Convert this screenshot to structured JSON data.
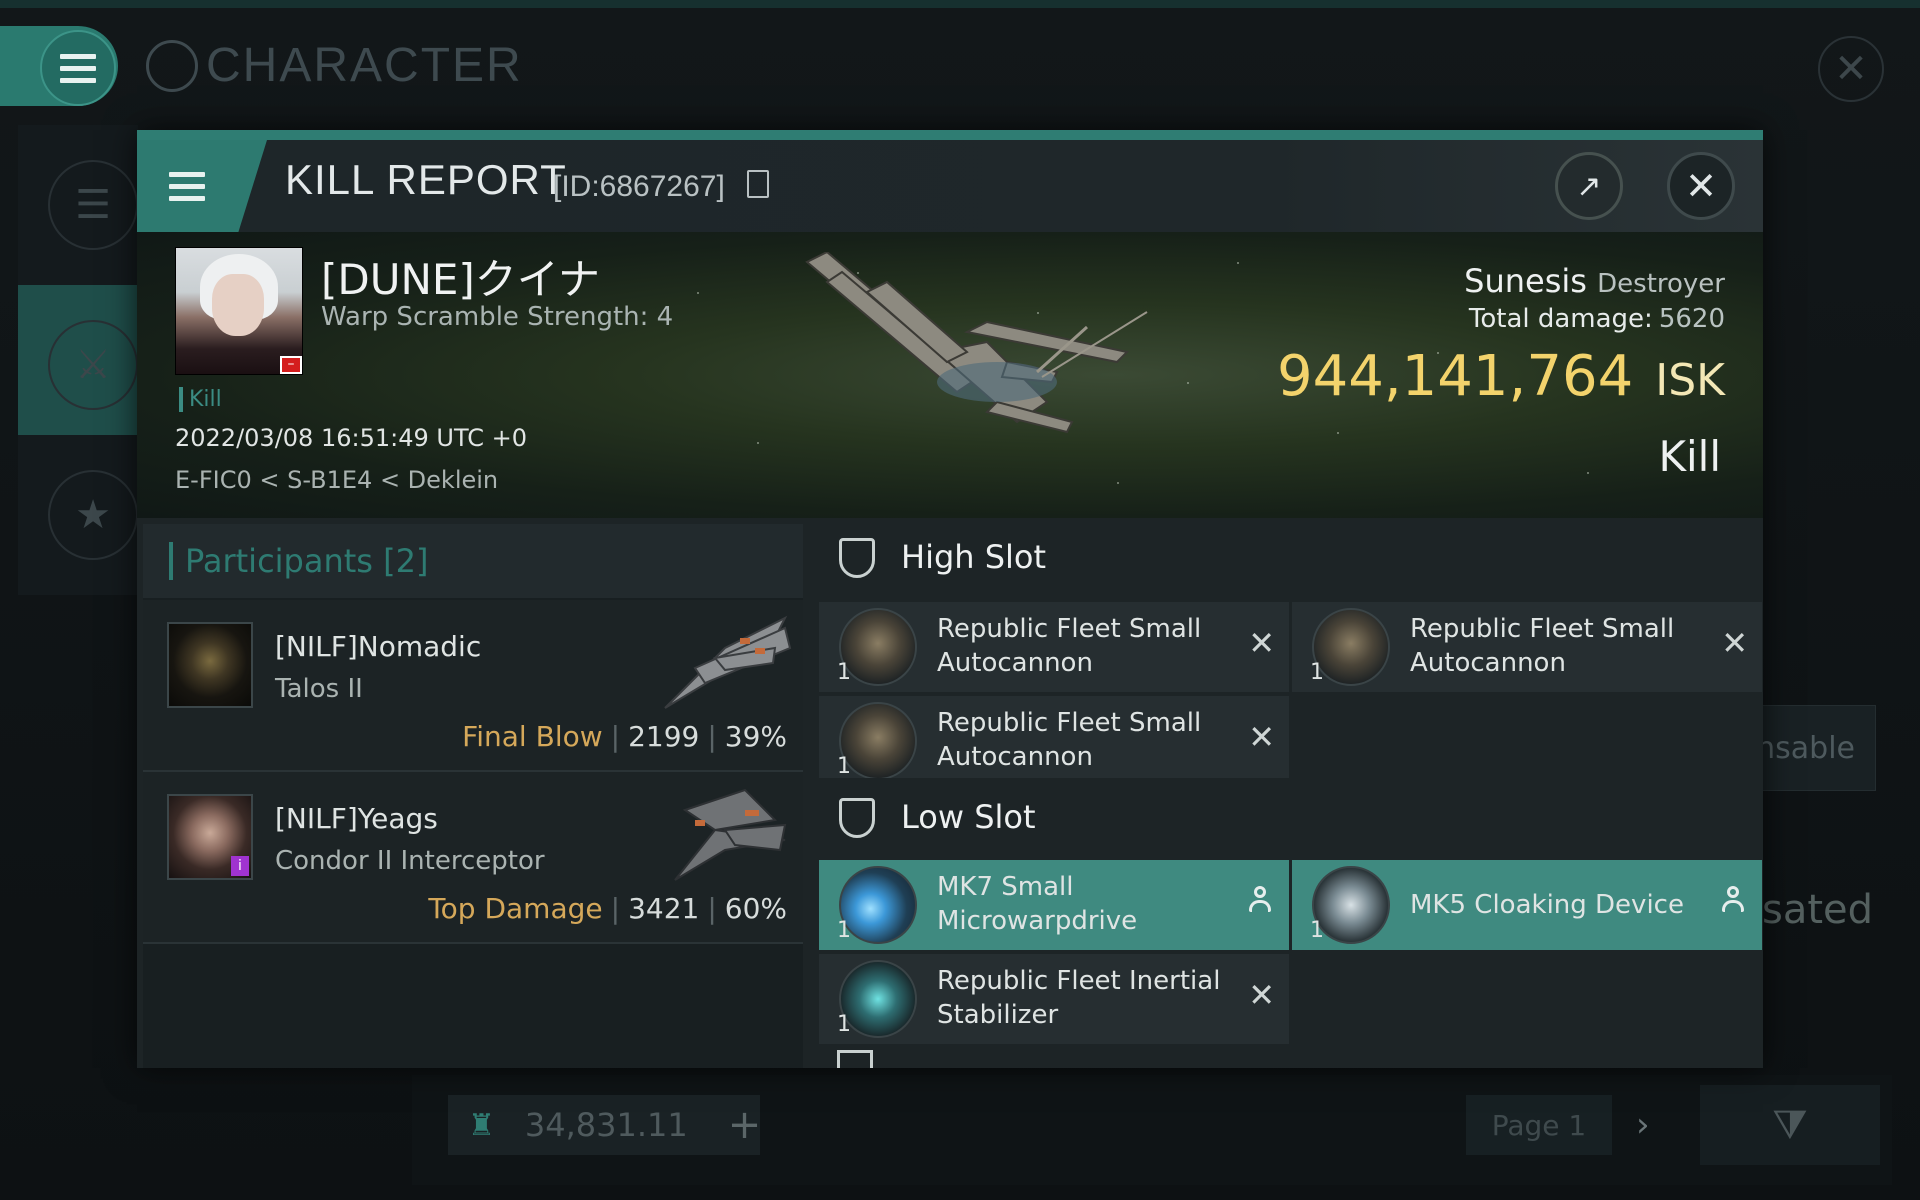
{
  "background_window": {
    "title": "CHARACTER",
    "right_button_1": "nsable",
    "right_text_2": "sated",
    "wallet_value": "34,831.11",
    "wallet_add": "+",
    "page_label": "Page 1",
    "next": "›"
  },
  "kill_report": {
    "title": "KILL REPORT",
    "id_label": "[ID:6867267]",
    "victim": {
      "name": "[DUNE]クイナ",
      "warp_scramble": "Warp Scramble Strength: 4",
      "tag": "Kill",
      "datetime": "2022/03/08 16:51:49 UTC +0",
      "location": "E-FIC0 < S-B1E4 < Deklein"
    },
    "ship": {
      "name": "Sunesis",
      "class": "Destroyer",
      "total_damage_label": "Total damage:",
      "total_damage": "5620",
      "value": "944,141,764",
      "currency": "ISK",
      "kind": "Kill"
    },
    "participants": {
      "label": "Participants",
      "count": "[2]",
      "items": [
        {
          "name": "[NILF]Nomadic",
          "ship": "Talos II",
          "role": "Final Blow",
          "damage": "2199",
          "percent": "39%"
        },
        {
          "name": "[NILF]Yeags",
          "ship": "Condor II Interceptor",
          "role": "Top Damage",
          "damage": "3421",
          "percent": "60%"
        }
      ]
    },
    "slots": {
      "high": {
        "label": "High Slot",
        "modules": [
          {
            "qty": "1",
            "name": "Republic Fleet Small Autocannon",
            "status": "destroyed"
          },
          {
            "qty": "1",
            "name": "Republic Fleet Small Autocannon",
            "status": "destroyed"
          },
          {
            "qty": "1",
            "name": "Republic Fleet Small Autocannon",
            "status": "destroyed"
          }
        ]
      },
      "low": {
        "label": "Low Slot",
        "modules": [
          {
            "qty": "1",
            "name": "MK7 Small Microwarpdrive",
            "status": "dropped"
          },
          {
            "qty": "1",
            "name": "MK5 Cloaking Device",
            "status": "dropped"
          },
          {
            "qty": "1",
            "name": "Republic Fleet Inertial Stabilizer",
            "status": "destroyed"
          }
        ]
      }
    }
  },
  "colors": {
    "accent": "#2f7d73",
    "isk_gold": "#f3d36c",
    "final_blow": "#d5a85a",
    "dropped_highlight": "#3f8a80"
  },
  "icons": {
    "menu": "hamburger-icon",
    "close": "close-icon",
    "external": "external-link-icon",
    "copy": "copy-icon",
    "slot": "shield-icon",
    "destroyed": "x-icon",
    "dropped": "person-icon"
  }
}
